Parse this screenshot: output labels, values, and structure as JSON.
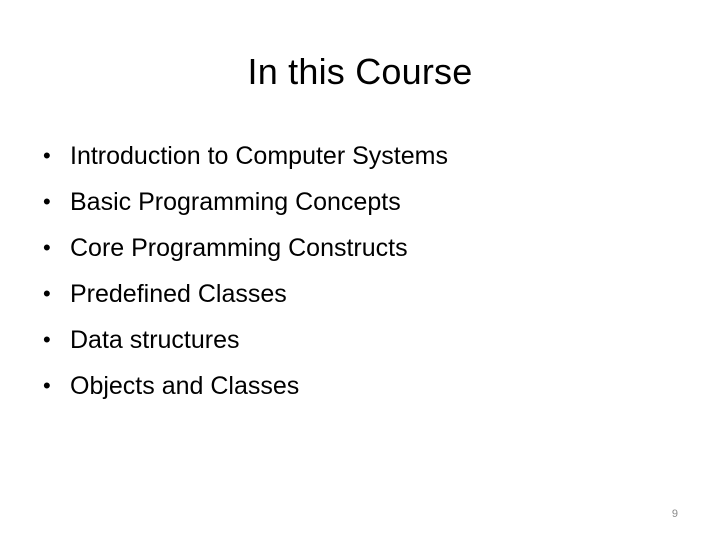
{
  "slide": {
    "title": "In this Course",
    "bullet_symbol": "•",
    "items": [
      "Introduction to Computer Systems",
      "Basic Programming Concepts",
      "Core Programming Constructs",
      "Predefined Classes",
      "Data structures",
      "Objects and Classes"
    ],
    "page_number": "9",
    "colors": {
      "background": "#ffffff",
      "text": "#000000",
      "page_number": "#8a8a8a"
    }
  }
}
